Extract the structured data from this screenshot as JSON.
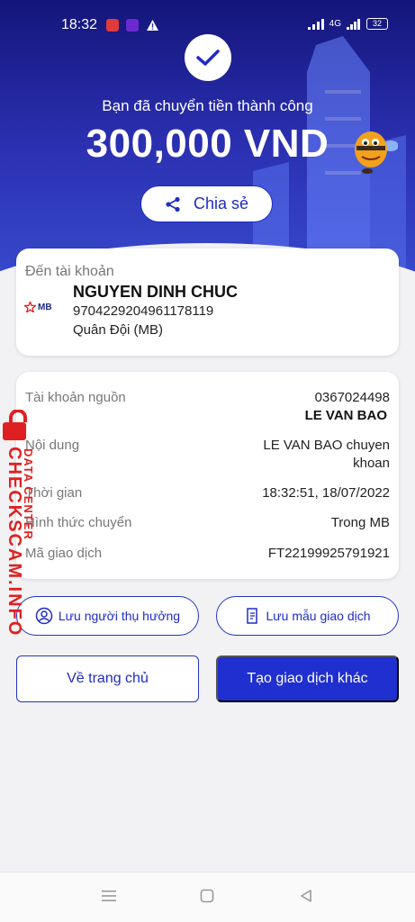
{
  "status_bar": {
    "time": "18:32",
    "network_label": "4G",
    "battery": "32"
  },
  "hero": {
    "message": "Bạn đã chuyển tiền thành công",
    "amount": "300,000 VND",
    "share_label": "Chia sẻ"
  },
  "recipient": {
    "label": "Đến tài khoản",
    "bank_logo_text": "MB",
    "name": "NGUYEN DINH CHUC",
    "account_number": "9704229204961178119",
    "bank_name": "Quân Đội (MB)"
  },
  "details": [
    {
      "label": "Tài khoản nguồn",
      "value": "0367024498",
      "sub_value": "LE VAN BAO"
    },
    {
      "label": "Nội dung",
      "value": "LE VAN BAO chuyen",
      "sub_value": "khoan"
    },
    {
      "label": "Thời gian",
      "value": "18:32:51, 18/07/2022"
    },
    {
      "label": "Hình thức chuyển",
      "value": "Trong MB"
    },
    {
      "label": "Mã giao dịch",
      "value": "FT22199925791921"
    }
  ],
  "actions": {
    "save_beneficiary": "Lưu người thụ hưởng",
    "save_template": "Lưu mẫu giao dịch",
    "home": "Về trang chủ",
    "new_transaction": "Tạo giao dịch khác"
  },
  "watermark": {
    "line1": "DATA CENTER",
    "line2": "CHECKSCAM.INFO"
  },
  "colors": {
    "primary": "#1f2fd0",
    "hero_top": "#14157a",
    "watermark": "#e02020"
  }
}
